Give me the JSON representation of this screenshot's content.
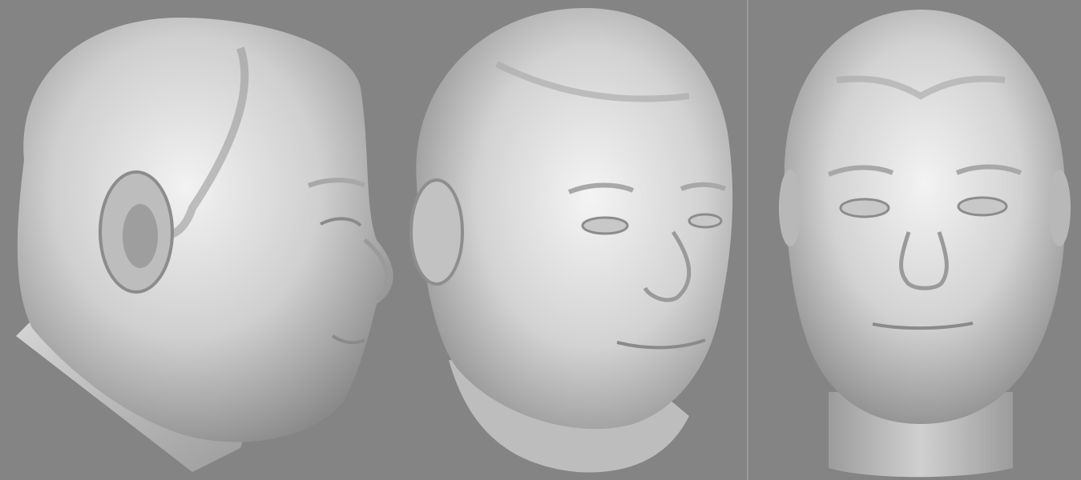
{
  "scene": {
    "background_color": "#848484",
    "surface_color": "#d4d4d4",
    "shadow_color": "#6e6e6e",
    "divider_color": "#9a9a9a"
  },
  "views": [
    {
      "view": "side"
    },
    {
      "view": "three-quarter"
    },
    {
      "view": "front"
    }
  ]
}
